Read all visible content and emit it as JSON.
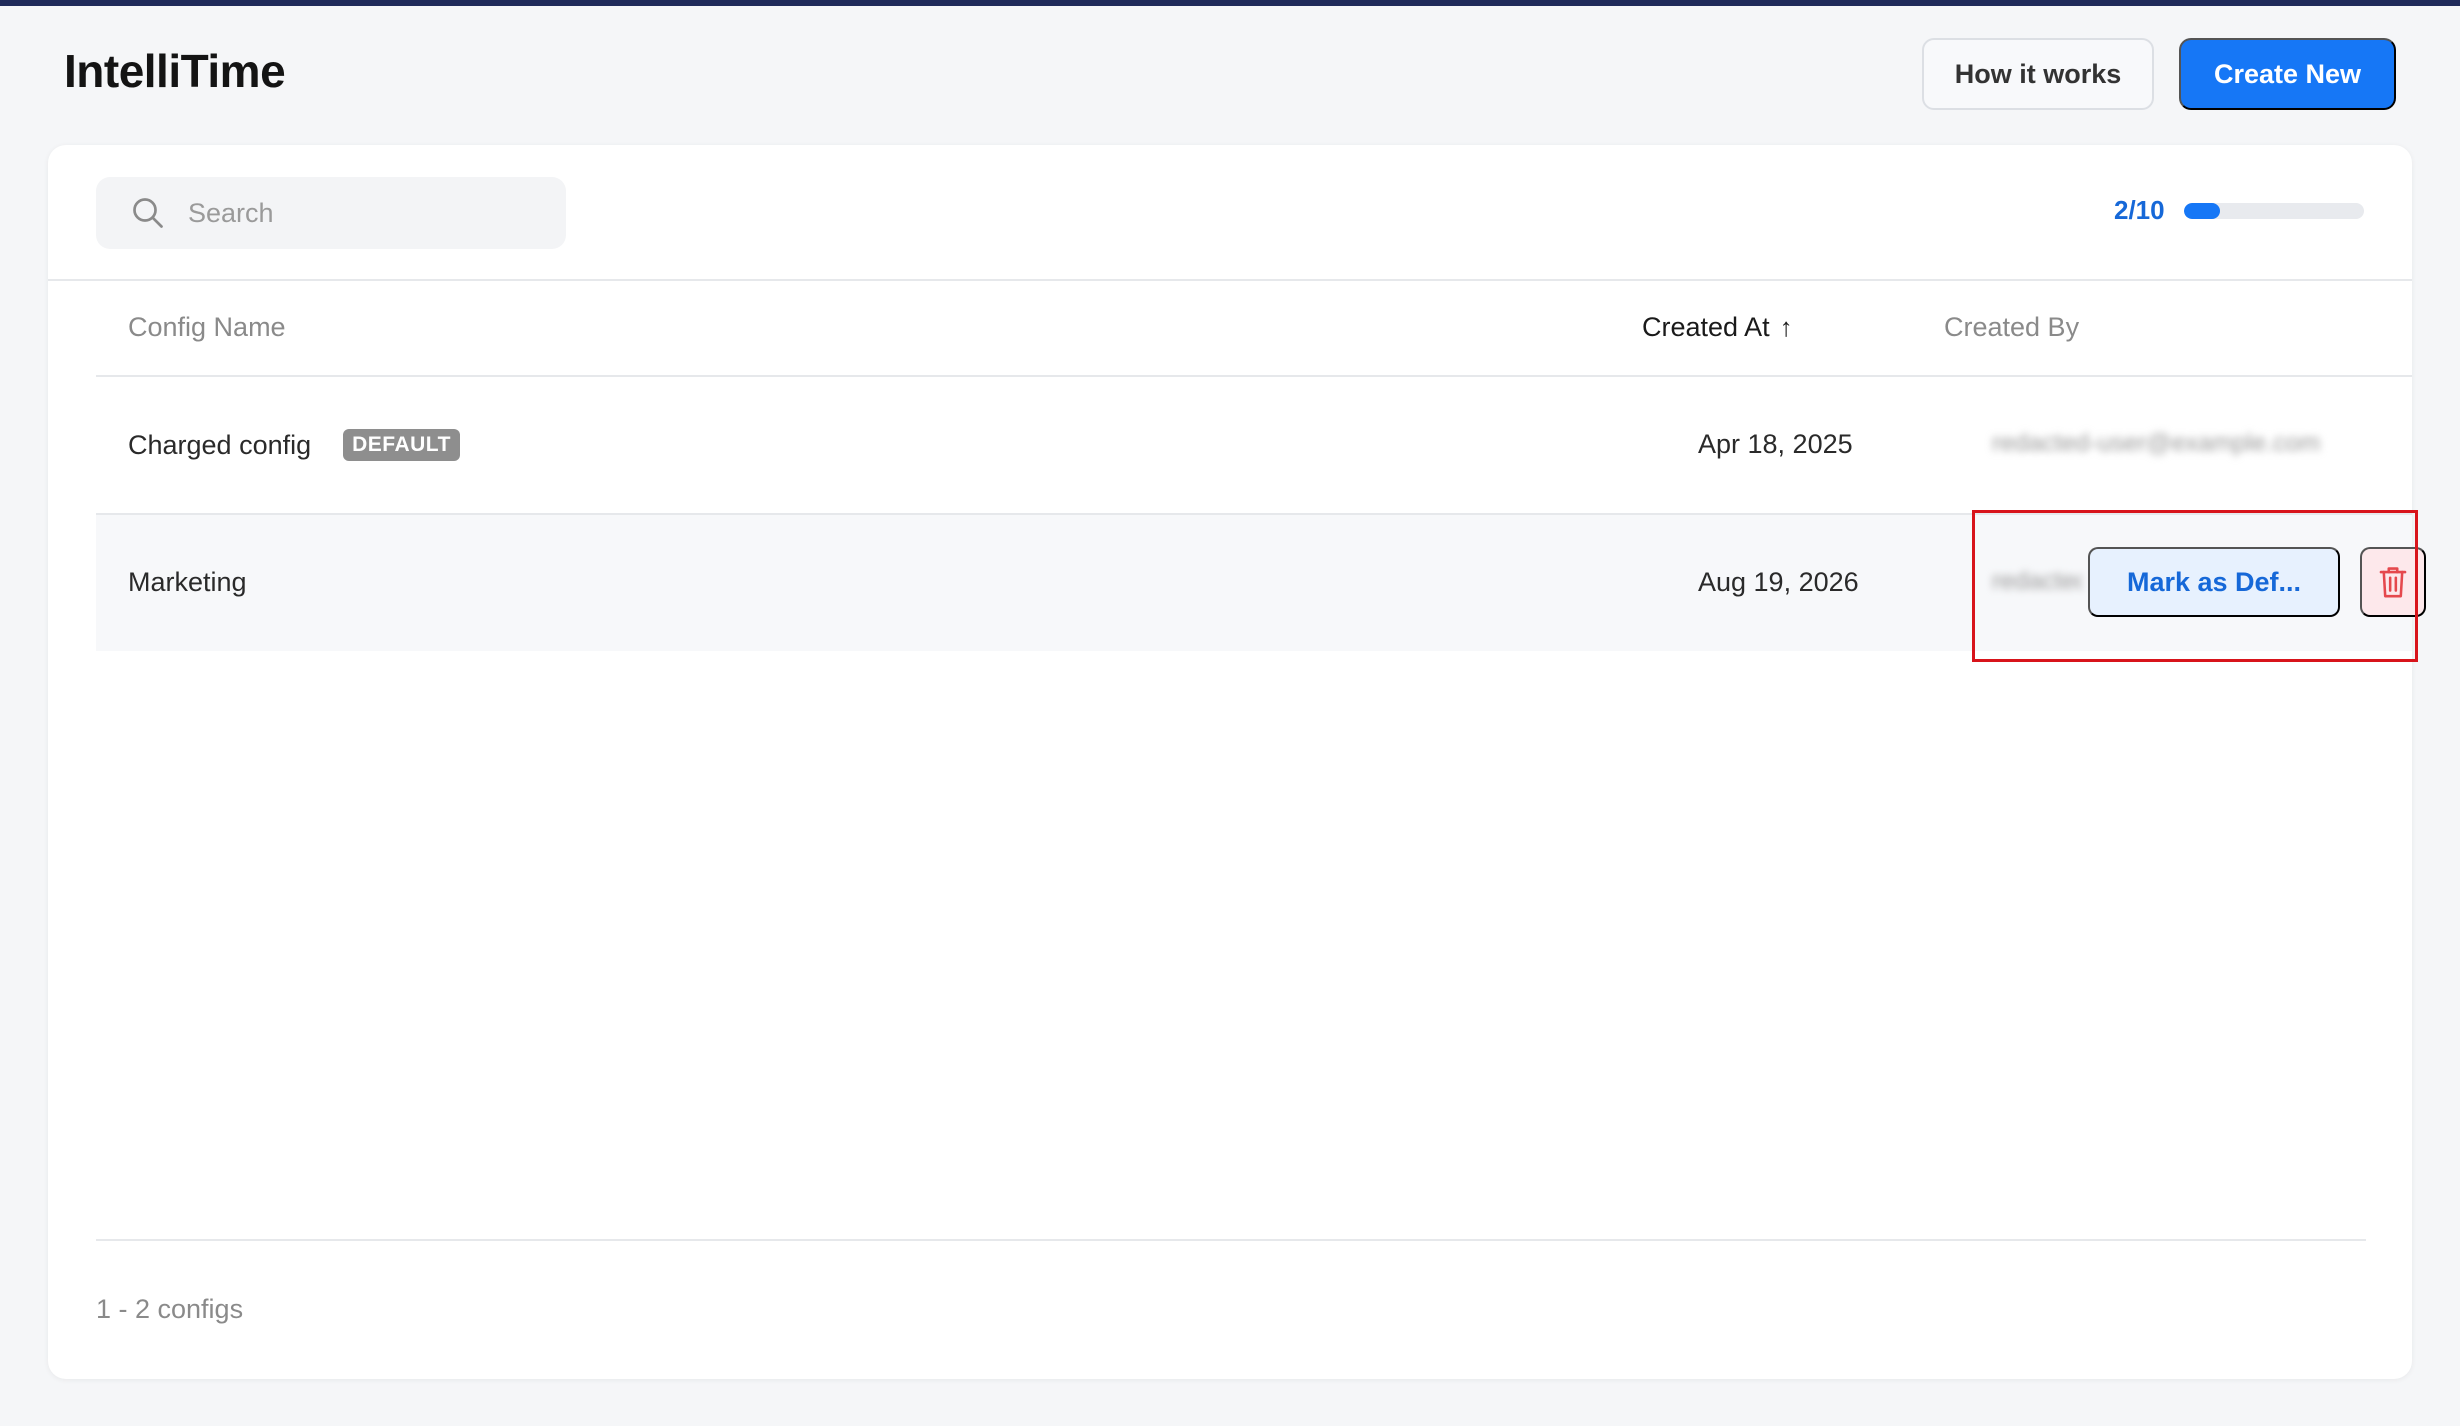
{
  "header": {
    "app_title": "IntelliTime",
    "how_it_works_label": "How it works",
    "create_new_label": "Create New"
  },
  "toolbar": {
    "search_placeholder": "Search",
    "usage_text": "2/10",
    "usage_fraction": 0.2
  },
  "table": {
    "columns": {
      "name": "Config Name",
      "created_at": "Created At",
      "created_by": "Created By"
    },
    "sort_arrow": "↑",
    "rows": [
      {
        "name": "Charged config",
        "badge": "DEFAULT",
        "created_at": "Apr 18, 2025",
        "created_by": "redacted-user@example.com"
      },
      {
        "name": "Marketing",
        "created_at": "Aug 19, 2026",
        "created_by": "redacted",
        "mark_default_label": "Mark as Def..."
      }
    ]
  },
  "footer": {
    "count_text": "1 - 2 configs"
  },
  "icons": {
    "search": "search-icon",
    "delete": "trash-icon"
  },
  "colors": {
    "primary": "#1677f6",
    "danger": "#e5484d",
    "highlight": "#d8141b"
  }
}
